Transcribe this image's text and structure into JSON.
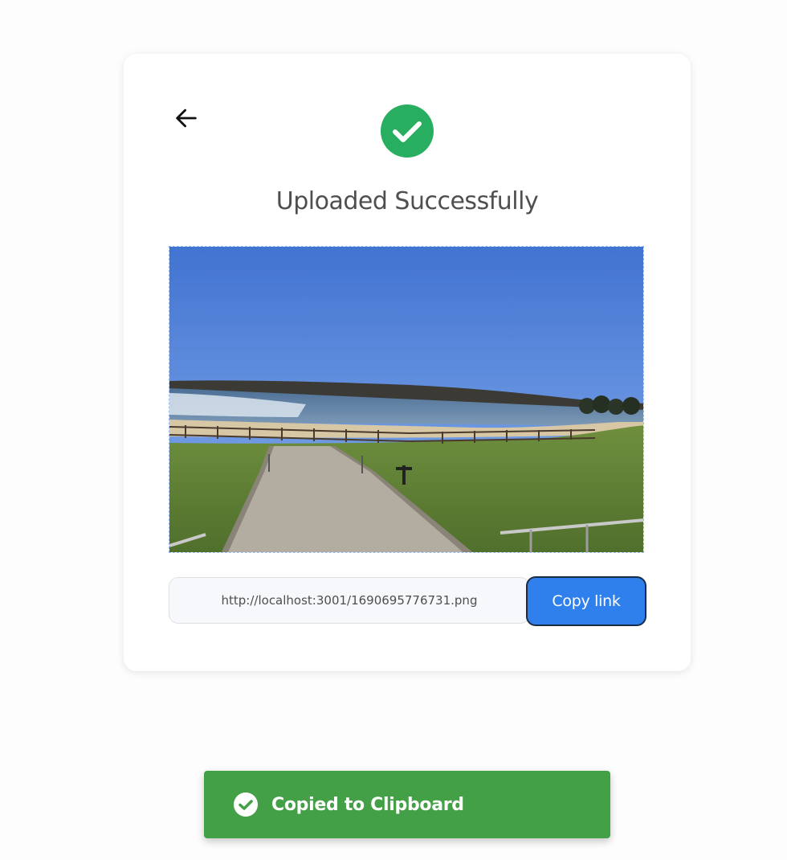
{
  "card": {
    "title": "Uploaded Successfully",
    "icons": {
      "back": "arrow-left-icon",
      "status": "check-circle-icon",
      "status_color": "#27ae60"
    },
    "image": {
      "alt": "Uploaded image preview: lakeside beach with fence, path and lawn under blue sky"
    },
    "link": {
      "value": "http://localhost:3001/1690695776731.png",
      "button_label": "Copy link",
      "button_color": "#2f80ed"
    }
  },
  "toast": {
    "message": "Copied to Clipboard",
    "icon": "check-circle-icon",
    "color": "#43a047"
  }
}
